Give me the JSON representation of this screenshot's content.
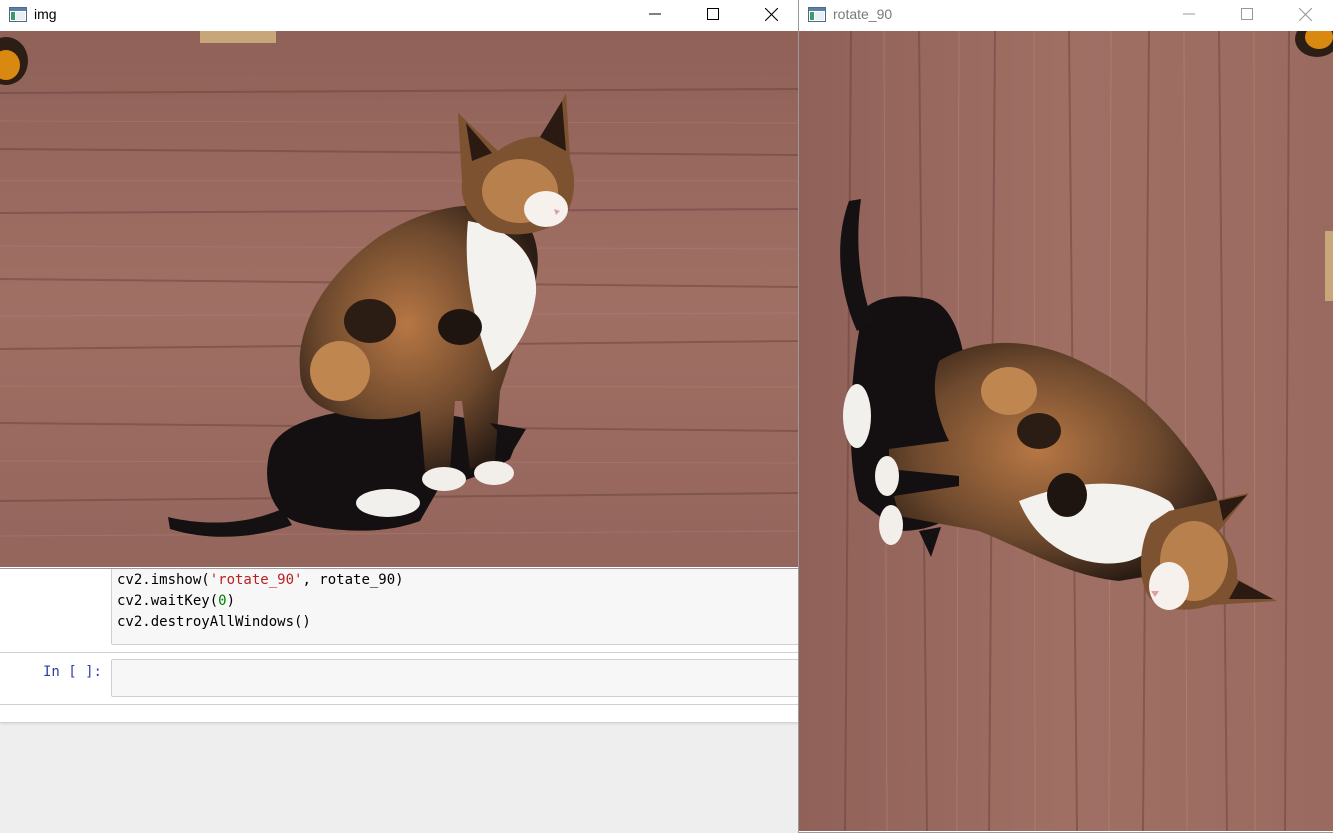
{
  "notebook": {
    "prev_cell": {
      "lines": [
        {
          "pre": "cv2.imshow(",
          "str": "'rotate_90'",
          "post": ", rotate_90)"
        },
        {
          "pre": "cv2.waitKey(",
          "num": "0",
          "post": ")"
        },
        {
          "pre": "cv2.destroyAllWindows()"
        }
      ]
    },
    "new_cell": {
      "prompt": "In [ ]:",
      "value": ""
    }
  },
  "windows": {
    "img": {
      "title": "img",
      "state": "active"
    },
    "rotate": {
      "title": "rotate_90",
      "state": "inactive"
    }
  },
  "icons": {
    "app": "opencv-window-icon",
    "minimize": "minimize-icon",
    "maximize": "maximize-icon",
    "close": "close-icon"
  },
  "colors": {
    "wood": "#9b6a5f",
    "code_string": "#ba2121",
    "code_number": "#008000",
    "prompt": "#303f9f"
  }
}
